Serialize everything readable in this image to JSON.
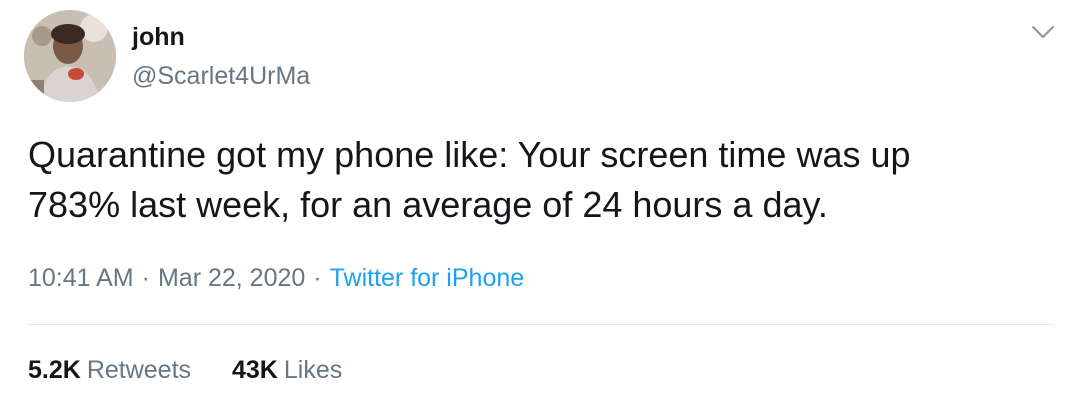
{
  "user": {
    "display_name": "john",
    "handle": "@Scarlet4UrMa"
  },
  "tweet": {
    "text": "Quarantine got my phone like: Your screen time was up\n783% last week, for an average of 24 hours a day."
  },
  "meta": {
    "time": "10:41 AM",
    "separator": "·",
    "date": "Mar 22, 2020",
    "source": "Twitter for iPhone"
  },
  "stats": {
    "retweets_count": "5.2K",
    "retweets_label": "Retweets",
    "likes_count": "43K",
    "likes_label": "Likes"
  },
  "icons": {
    "caret": "chevron-down-icon"
  },
  "colors": {
    "text": "#14171a",
    "secondary": "#657786",
    "link": "#1da1f2",
    "divider": "#e1e8ed"
  }
}
